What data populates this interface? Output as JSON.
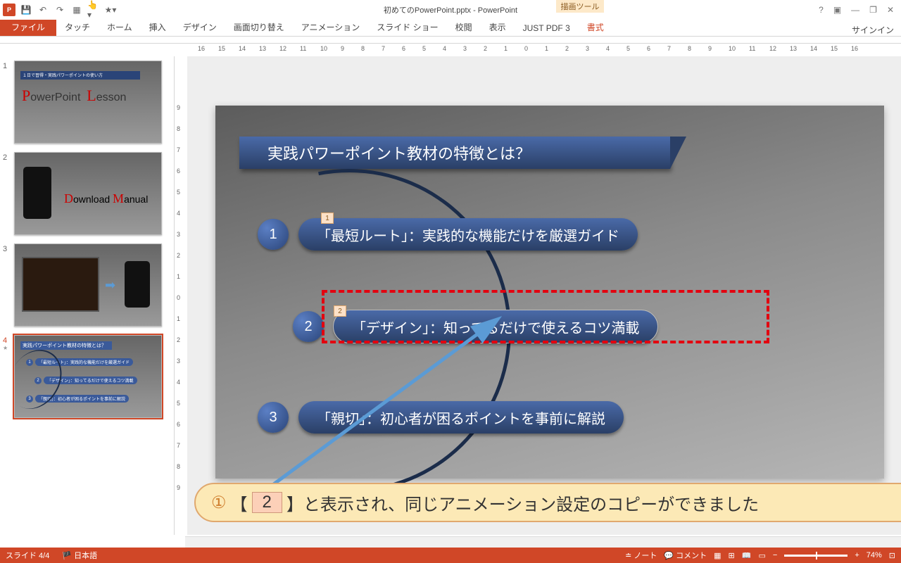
{
  "app": {
    "title": "初めてのPowerPoint.pptx - PowerPoint",
    "drawtool_label": "描画ツール",
    "signin": "サインイン"
  },
  "win": {
    "help": "?",
    "ribbon": "▣",
    "min": "—",
    "restore": "❐",
    "close": "✕"
  },
  "tabs": {
    "file": "ファイル",
    "touch": "タッチ",
    "home": "ホーム",
    "insert": "挿入",
    "design": "デザイン",
    "transition": "画面切り替え",
    "animation": "アニメーション",
    "slideshow": "スライド ショー",
    "review": "校閲",
    "view": "表示",
    "justpdf": "JUST PDF 3",
    "format": "書式"
  },
  "hruler_ticks": [
    "16",
    "15",
    "14",
    "13",
    "12",
    "11",
    "10",
    "9",
    "8",
    "7",
    "6",
    "5",
    "4",
    "3",
    "2",
    "1",
    "0",
    "1",
    "2",
    "3",
    "4",
    "5",
    "6",
    "7",
    "8",
    "9",
    "10",
    "11",
    "12",
    "13",
    "14",
    "15",
    "16"
  ],
  "vruler_ticks": [
    "9",
    "8",
    "7",
    "6",
    "5",
    "4",
    "3",
    "2",
    "1",
    "0",
    "1",
    "2",
    "3",
    "4",
    "5",
    "6",
    "7",
    "8",
    "9"
  ],
  "thumbs": {
    "1": {
      "bar": "１日で習得・実践パワーポイントの使い方",
      "p": "P",
      "pw": "owerPoint",
      "l": "L",
      "ls": "esson"
    },
    "4": {
      "title": "実践パワーポイント教材の特徴とは？",
      "i1": {
        "n": "1",
        "t": "「最短ルート」：実践的な機能だけを厳選ガイド"
      },
      "i2": {
        "n": "2",
        "t": "「デザイン」：知ってるだけで使えるコツ満載"
      },
      "i3": {
        "n": "3",
        "t": "「親切」：初心者が困るポイントを事前に解説"
      }
    }
  },
  "slide": {
    "title": "実践パワーポイント教材の特徴とは？",
    "items": [
      {
        "n": "1",
        "t": "「最短ルート」：実践的な機能だけを厳選ガイド",
        "tag": "1"
      },
      {
        "n": "2",
        "t": "「デザイン」：知ってるだけで使えるコツ満載",
        "tag": "2"
      },
      {
        "n": "3",
        "t": "「親切」：初心者が困るポイントを事前に解説"
      }
    ]
  },
  "callout": {
    "num": "①",
    "b1": "【",
    "badge": "2",
    "b2": "】",
    "text": "と表示され、同じアニメーション設定のコピーができました"
  },
  "status": {
    "slide": "スライド 4/4",
    "lang": "日本語",
    "notes": "ノート",
    "comments": "コメント",
    "zoom": "74%"
  }
}
